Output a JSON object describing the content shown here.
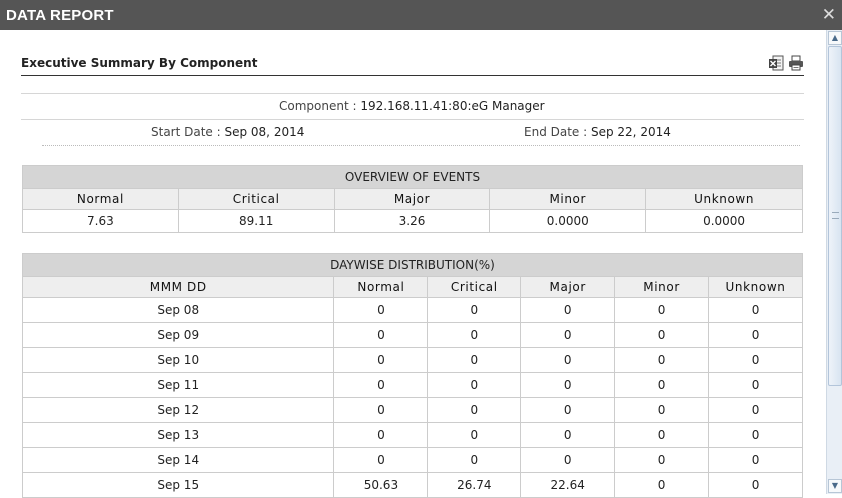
{
  "window": {
    "title": "DATA REPORT",
    "close_glyph": "✕"
  },
  "report": {
    "title": "Executive Summary By Component",
    "component_label": "Component : ",
    "component_value": "192.168.11.41:80:eG Manager",
    "start_label": "Start Date : ",
    "start_value": "Sep 08, 2014",
    "end_label": "End Date : ",
    "end_value": "Sep 22, 2014"
  },
  "toolbar": {
    "excel_icon": "excel-export-icon",
    "print_icon": "printer-icon"
  },
  "overview": {
    "caption": "OVERVIEW OF EVENTS",
    "headers": [
      "Normal",
      "Critical",
      "Major",
      "Minor",
      "Unknown"
    ],
    "values": [
      "7.63",
      "89.11",
      "3.26",
      "0.0000",
      "0.0000"
    ]
  },
  "daywise": {
    "caption": "DAYWISE DISTRIBUTION(%)",
    "headers": [
      "MMM DD",
      "Normal",
      "Critical",
      "Major",
      "Minor",
      "Unknown"
    ],
    "rows": [
      [
        "Sep 08",
        "0",
        "0",
        "0",
        "0",
        "0"
      ],
      [
        "Sep 09",
        "0",
        "0",
        "0",
        "0",
        "0"
      ],
      [
        "Sep 10",
        "0",
        "0",
        "0",
        "0",
        "0"
      ],
      [
        "Sep 11",
        "0",
        "0",
        "0",
        "0",
        "0"
      ],
      [
        "Sep 12",
        "0",
        "0",
        "0",
        "0",
        "0"
      ],
      [
        "Sep 13",
        "0",
        "0",
        "0",
        "0",
        "0"
      ],
      [
        "Sep 14",
        "0",
        "0",
        "0",
        "0",
        "0"
      ],
      [
        "Sep 15",
        "50.63",
        "26.74",
        "22.64",
        "0",
        "0"
      ]
    ]
  },
  "scrollbar": {
    "up_glyph": "▲",
    "down_glyph": "▼"
  }
}
